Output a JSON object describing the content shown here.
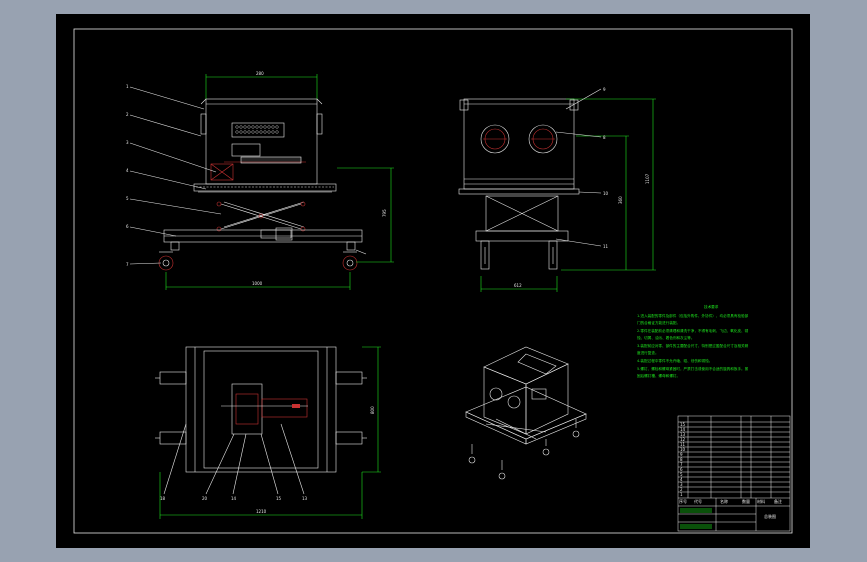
{
  "colors": {
    "background": "#98a2b1",
    "paper": "#000000",
    "line": "#e8e8e8",
    "dimension": "#1ee61e",
    "hidden": "#c83232",
    "accent": "#3fb0ff"
  },
  "front_view": {
    "balloons": [
      "1",
      "2",
      "3",
      "4",
      "5",
      "6",
      "7"
    ],
    "dims": {
      "width_top": "280",
      "length_base": "1000",
      "height": "795"
    }
  },
  "side_view": {
    "balloons": [
      "9",
      "8",
      "10",
      "11"
    ],
    "dims": {
      "width": "612",
      "height_total": "1107",
      "height_inner": "360"
    }
  },
  "top_view": {
    "balloons": [
      "18",
      "20",
      "14",
      "15",
      "13"
    ],
    "dims": {
      "length": "1210",
      "width": "800"
    }
  },
  "tech_notes": {
    "title": "技术要求",
    "lines": [
      "1.进入装配的零件及部件（包括外购件、外协件），均必须具有检验部",
      "门的合格证方能进行装配。",
      "2.零件在装配前必须清理和清洗干净，不得有毛刺、飞边、氧化皮、锈",
      "蚀、切屑、油污、着色剂和灰尘等。",
      "3.装配前应对零、部件的主要配合尺寸，特别是过盈配合尺寸及相关精",
      "度进行复查。",
      "4.装配过程中零件不允许磕、碰、划伤和锈蚀。",
      "5.螺钉、螺栓和螺母紧固时，严禁打击或使用不合适的旋具和扳手。紧",
      "固后螺钉槽、螺母和螺钉。"
    ]
  },
  "title_block": {
    "rows": [
      "1",
      "2",
      "3",
      "4",
      "5",
      "6",
      "7",
      "8",
      "9",
      "10",
      "11",
      "12",
      "13",
      "14",
      "15"
    ],
    "headers": [
      "序号",
      "代号",
      "名称",
      "数量",
      "材料",
      "备注"
    ],
    "drawing_title": "总装图"
  }
}
